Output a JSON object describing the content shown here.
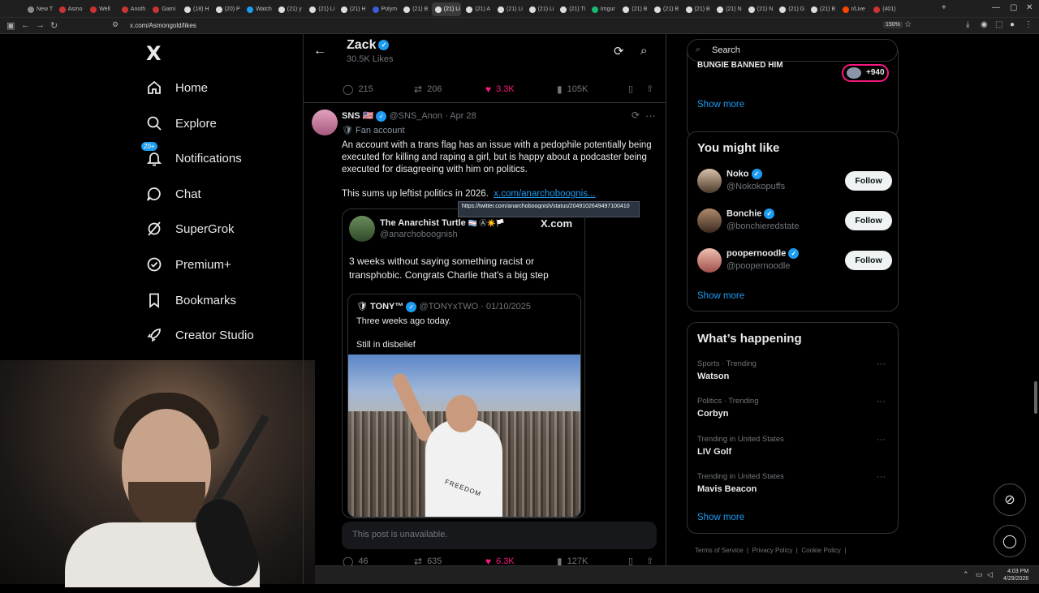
{
  "browser": {
    "tabs": [
      "New T",
      "Asmo",
      "Well",
      "Anoth",
      "Gami",
      "(18) H",
      "(20) P",
      "Watch",
      "(21) y",
      "(21) Li",
      "(21) H",
      "Polym",
      "(21) B",
      "(21) Li",
      "(21) A",
      "(21) Li",
      "(21) Li",
      "(21) Ti",
      "Imgur",
      "(21) B",
      "(21) B",
      "(21) B",
      "(21) N",
      "(21) N",
      "(21) G",
      "(21) B",
      "r/Live",
      "(401)"
    ],
    "active_tab_index": 13,
    "url": "x.com/Asmongold/likes",
    "zoom": "150%"
  },
  "sidebar": {
    "logo": "X",
    "notif_badge": "20+",
    "items": [
      {
        "label": "Home",
        "icon": "home-icon"
      },
      {
        "label": "Explore",
        "icon": "search-icon"
      },
      {
        "label": "Notifications",
        "icon": "bell-icon"
      },
      {
        "label": "Chat",
        "icon": "chat-icon"
      },
      {
        "label": "SuperGrok",
        "icon": "grok-icon"
      },
      {
        "label": "Premium+",
        "icon": "verified-icon"
      },
      {
        "label": "Bookmarks",
        "icon": "bookmark-icon"
      },
      {
        "label": "Creator Studio",
        "icon": "rocket-icon"
      }
    ]
  },
  "feed": {
    "title": "Zack",
    "subtitle": "30.5K Likes",
    "prev_actions": {
      "replies": "215",
      "reposts": "206",
      "likes": "3.3K",
      "views": "105K"
    },
    "post": {
      "name": "SNS",
      "flag": "🇺🇸",
      "handle": "@SNS_Anon",
      "date": "Apr 28",
      "tag": "Fan account",
      "text1": "An account with a trans flag has an issue with a pedophile potentially being executed for killing and raping a girl, but is happy about a podcaster being executed for disagreeing with him on politics.",
      "text2": "This sums up leftist politics in 2026.",
      "link": "x.com/anarchoboognis...",
      "tooltip": "https://twitter.com/anarchoboognish/status/2049102649497100410"
    },
    "quote": {
      "name": "The Anarchist Turtle",
      "emojis": "🏳️‍⚧️ Ⓐ☀️🏳️",
      "handle": "@anarchoboognish",
      "source": "X.com",
      "text": "3 weeks without saying something racist or transphobic. Congrats Charlie that's a big step",
      "inner": {
        "name": "TONY™",
        "handle": "@TONYxTWO",
        "date": "01/10/2025",
        "line1": "Three weeks ago today.",
        "line2": "Still in disbelief",
        "shirt_text": "FREEDOM"
      }
    },
    "unavailable": "This post is unavailable.",
    "post_actions": {
      "replies": "46",
      "reposts": "635",
      "likes": "6.3K",
      "views": "127K"
    }
  },
  "right": {
    "search_placeholder": "Search",
    "top_box": {
      "text": "BUNGIE BANNED HIM",
      "pill_count": "+940",
      "show_more": "Show more"
    },
    "might_like": {
      "title": "You might like",
      "users": [
        {
          "name": "Noko",
          "handle": "@Nokokopuffs",
          "button": "Follow"
        },
        {
          "name": "Bonchie",
          "handle": "@bonchieredstate",
          "button": "Follow"
        },
        {
          "name": "poopernoodle",
          "handle": "@poopernoodle",
          "button": "Follow"
        }
      ],
      "show_more": "Show more"
    },
    "happening": {
      "title": "What’s happening",
      "trends": [
        {
          "category": "Sports · Trending",
          "topic": "Watson"
        },
        {
          "category": "Politics · Trending",
          "topic": "Corbyn"
        },
        {
          "category": "Trending in United States",
          "topic": "LIV Golf"
        },
        {
          "category": "Trending in United States",
          "topic": "Mavis Beacon"
        }
      ],
      "show_more": "Show more"
    },
    "footer": [
      "Terms of Service",
      "Privacy Policy",
      "Cookie Policy"
    ]
  },
  "taskbar": {
    "time": "4:03 PM",
    "date": "4/29/2026"
  },
  "colors": {
    "accent": "#1d9bf0",
    "like": "#f91880",
    "border": "#2f3336",
    "muted": "#71767b"
  }
}
